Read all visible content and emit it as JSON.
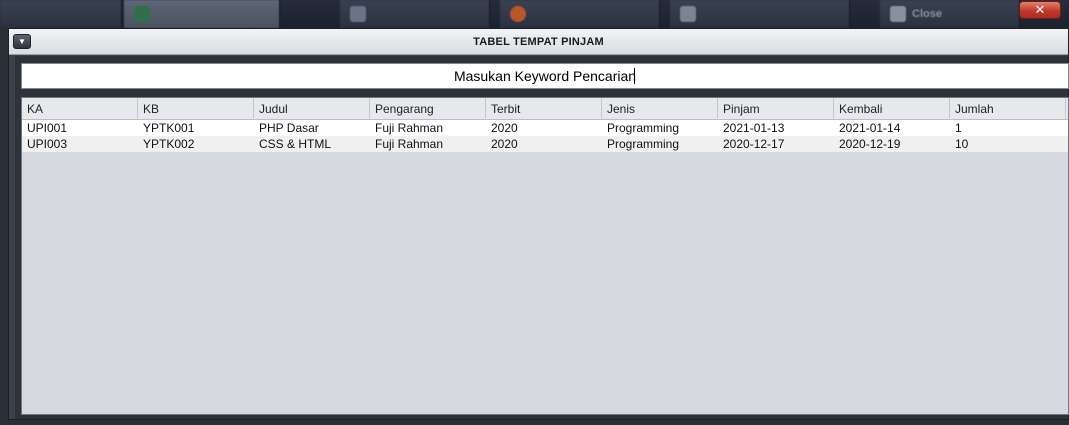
{
  "dialog": {
    "title": "TABEL TEMPAT PINJAM",
    "menu_icon": "chevron-down-icon"
  },
  "search": {
    "value": "Masukan Keyword Pencarian"
  },
  "table": {
    "columns": [
      "KA",
      "KB",
      "Judul",
      "Pengarang",
      "Terbit",
      "Jenis",
      "Pinjam",
      "Kembali",
      "Jumlah"
    ],
    "rows": [
      [
        "UPI001",
        "YPTK001",
        "PHP Dasar",
        "Fuji Rahman",
        "2020",
        "Programming",
        "2021-01-13",
        "2021-01-14",
        "1"
      ],
      [
        "UPI003",
        "YPTK002",
        "CSS & HTML",
        "Fuji Rahman",
        "2020",
        "Programming",
        "2020-12-17",
        "2020-12-19",
        "10"
      ]
    ]
  },
  "background_app": {
    "close_label": "Close",
    "close_icon": "x-icon"
  },
  "colors": {
    "dialog_bg": "#3b414a",
    "table_bg": "#d6d9e0",
    "close_red": "#c0392b"
  }
}
